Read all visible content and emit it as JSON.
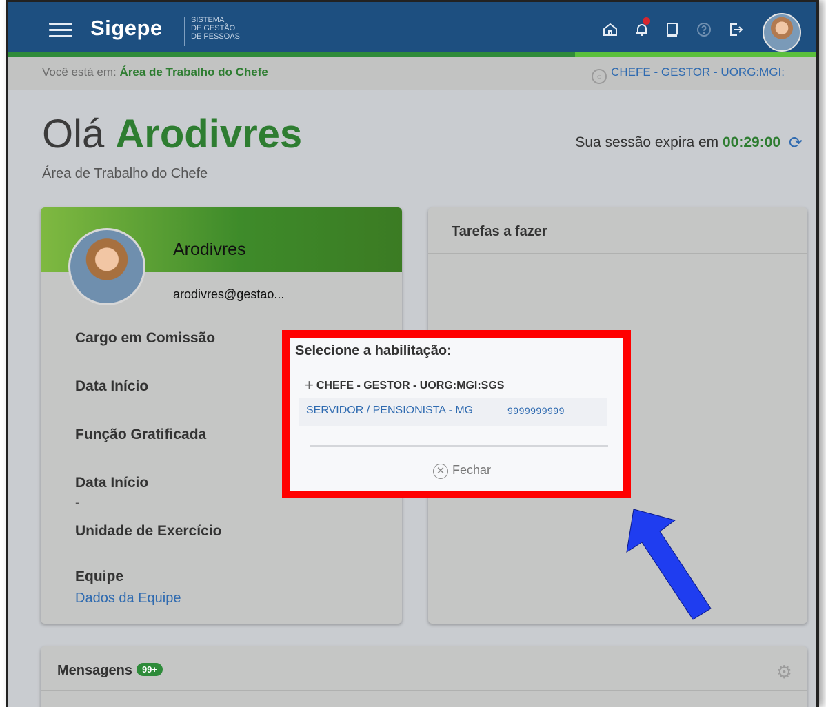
{
  "header": {
    "brand": "Sigepe",
    "brand_sub_1": "SISTEMA",
    "brand_sub_2": "DE GESTÃO",
    "brand_sub_3": "DE PESSOAS"
  },
  "breadcrumb": {
    "prefix": "Você está em:",
    "current": "Área de Trabalho do Chefe"
  },
  "profile_chip": "CHEFE - GESTOR - UORG:MGI:",
  "greeting": {
    "hello": "Olá",
    "name": "Arodivres",
    "subtitle": "Área de Trabalho do Chefe"
  },
  "session": {
    "label": "Sua sessão expira em",
    "time": "00:29:00"
  },
  "profile_card": {
    "name": "Arodivres",
    "email": "arodivres@gestao...",
    "fields": [
      {
        "label": "Cargo em Comissão"
      },
      {
        "label": "Data Início"
      },
      {
        "label": "Função Gratificada"
      },
      {
        "label": "Data Início",
        "value": "-"
      },
      {
        "label": "Unidade de Exercício"
      },
      {
        "label": "Equipe",
        "link": "Dados da Equipe"
      }
    ]
  },
  "tasks_card": {
    "title": "Tarefas a fazer"
  },
  "messages_card": {
    "title": "Mensagens",
    "badge": "99+"
  },
  "modal": {
    "title": "Selecione a habilitação:",
    "option1": "CHEFE - GESTOR - UORG:MGI:SGS",
    "option2_label": "SERVIDOR / PENSIONISTA - MG",
    "option2_code": "9999999999",
    "close": "Fechar"
  },
  "colors": {
    "header_blue": "#1d4f80",
    "brand_green": "#2e7d31",
    "link_blue": "#2e6ab0",
    "highlight_red": "#ff0000",
    "arrow_blue": "#1f3df0"
  }
}
